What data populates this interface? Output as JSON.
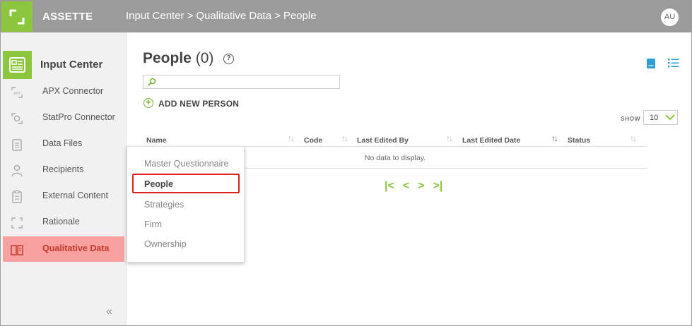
{
  "header": {
    "app_name": "ASSETTE",
    "breadcrumb": [
      "Input Center",
      "Qualitative Data",
      "People"
    ],
    "separator": ">",
    "avatar_initials": "AU"
  },
  "sidebar": {
    "title": "Input Center",
    "items": [
      {
        "label": "APX Connector",
        "icon": "apx-connector-icon"
      },
      {
        "label": "StatPro Connector",
        "icon": "statpro-connector-icon"
      },
      {
        "label": "Data Files",
        "icon": "data-files-icon"
      },
      {
        "label": "Recipients",
        "icon": "recipients-icon"
      },
      {
        "label": "External Content",
        "icon": "external-content-icon"
      },
      {
        "label": "Rationale",
        "icon": "rationale-icon"
      },
      {
        "label": "Qualitative Data",
        "icon": "qualitative-data-icon",
        "active": true
      }
    ],
    "collapse_glyph": "«"
  },
  "main": {
    "title": "People",
    "count": "(0)",
    "help_glyph": "?",
    "add_label": "ADD NEW PERSON",
    "show_label": "SHOW",
    "page_size": "10",
    "columns": [
      "Name",
      "Code",
      "Last Edited By",
      "Last Edited Date",
      "Status"
    ],
    "empty_message": "No data to display.",
    "pager": [
      "|<",
      "<",
      ">",
      ">|"
    ]
  },
  "menu": {
    "items": [
      "Master Questionnaire",
      "People",
      "Strategies",
      "Firm",
      "Ownership"
    ],
    "selected": "People"
  },
  "colors": {
    "brand_green": "#8cc63f",
    "header_gray": "#9b9b9b",
    "active_item_bg": "#f9a1a1",
    "active_item_text": "#c0392b",
    "highlight_red": "#e02020",
    "view_icon_blue": "#2a9fd8"
  }
}
